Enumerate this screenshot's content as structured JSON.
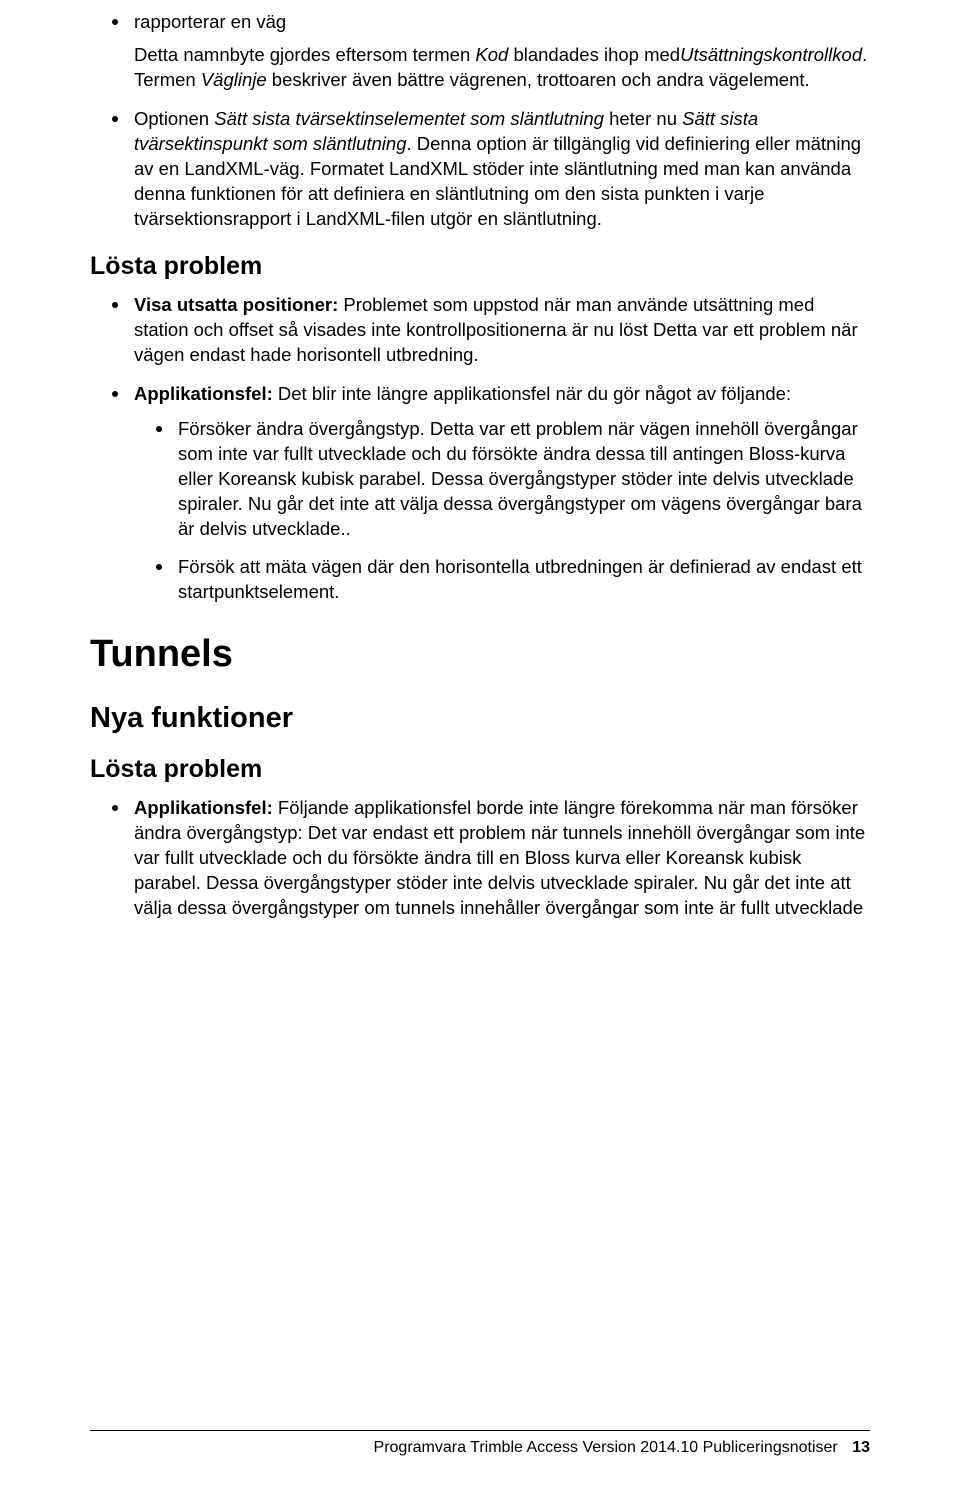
{
  "top": {
    "bullet_rapport": "rapporterar en väg",
    "para_namnbyte_1": "Detta namnbyte gjordes eftersom termen ",
    "para_namnbyte_kod": "Kod",
    "para_namnbyte_2": " blandades ihop med",
    "para_namnbyte_uts": "Utsättningskontrollkod",
    "para_namnbyte_3": ". Termen ",
    "para_namnbyte_vaglinje": "Väglinje",
    "para_namnbyte_4": " beskriver även bättre vägrenen, trottoaren och andra vägelement.",
    "bullet_option_1": "Optionen ",
    "bullet_option_i1": "Sätt sista tvärsektinselementet som släntlutning",
    "bullet_option_2": " heter nu ",
    "bullet_option_i2": "Sätt sista tvärsektinspunkt som släntlutning",
    "bullet_option_3": ". Denna option är tillgänglig vid definiering eller mätning av en LandXML-väg. Formatet LandXML stöder inte släntlutning med man kan använda denna funktionen för att definiera en släntlutning om den sista punkten i varje tvärsektionsrapport i LandXML-filen utgör en släntlutning."
  },
  "losta1": {
    "heading": "Lösta problem",
    "item1_b": "Visa utsatta positioner:",
    "item1_t": " Problemet som uppstod när man använde utsättning med station och offset så visades inte kontrollpositionerna är nu löst Detta var ett problem när vägen endast hade horisontell utbredning.",
    "item2_b": "Applikationsfel:",
    "item2_t": " Det blir inte längre applikationsfel när du gör något av följande:",
    "sub1": "Försöker ändra övergångstyp. Detta var ett problem när vägen innehöll övergångar som inte var fullt utvecklade och du försökte ändra dessa till antingen Bloss-kurva eller Koreansk kubisk parabel. Dessa övergångstyper stöder inte delvis utvecklade spiraler. Nu går det inte att välja dessa övergångstyper om vägens övergångar bara är delvis utvecklade..",
    "sub2": "Försök att mäta vägen där den horisontella utbredningen är definierad av endast ett startpunktselement."
  },
  "tunnels": {
    "heading": "Tunnels",
    "nya": "Nya funktioner",
    "losta": "Lösta problem",
    "app_b": "Applikationsfel:",
    "app_t": " Följande applikationsfel borde inte längre förekomma när man försöker ändra övergångstyp: Det var endast ett problem när tunnels innehöll övergångar som inte var fullt utvecklade och du försökte ändra till en Bloss kurva eller Koreansk kubisk parabel. Dessa övergångstyper stöder inte delvis utvecklade spiraler. Nu går det inte att välja dessa övergångstyper om tunnels innehåller övergångar som inte är fullt utvecklade"
  },
  "footer": {
    "text": "Programvara Trimble Access Version 2014.10 Publiceringsnotiser",
    "page": "13"
  }
}
